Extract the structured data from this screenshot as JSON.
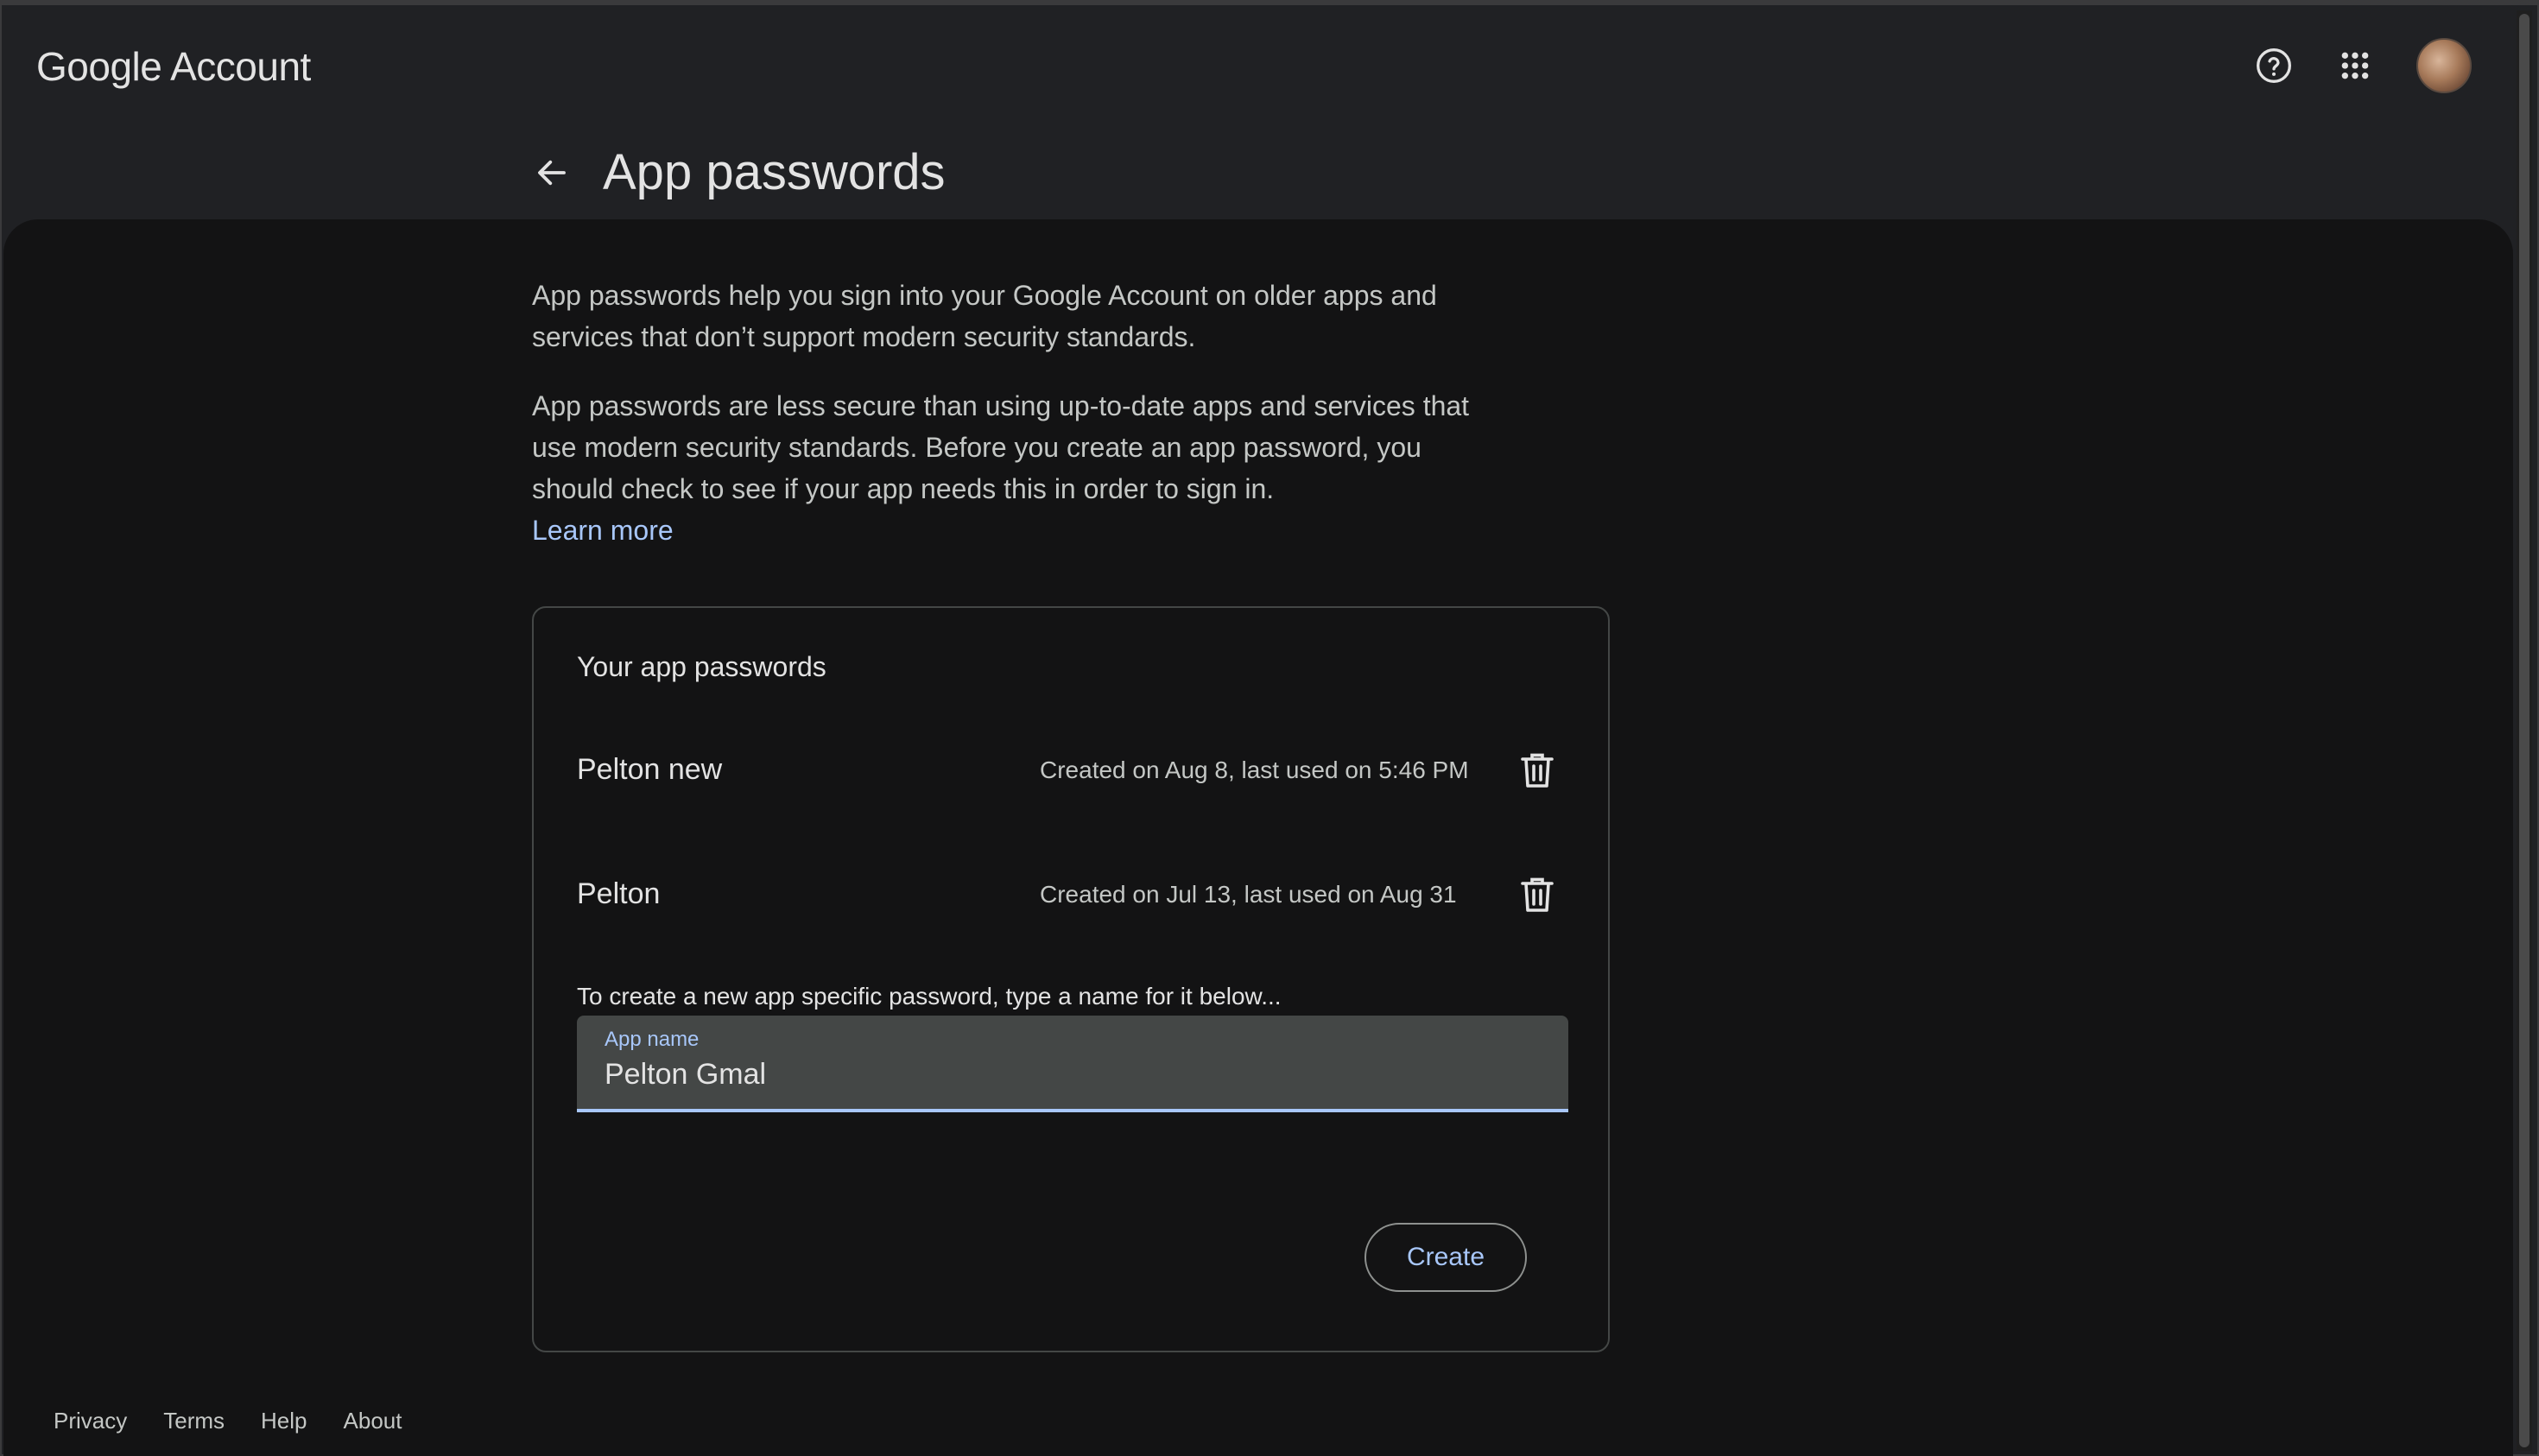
{
  "header": {
    "brand_google": "Google",
    "brand_account": "Account",
    "icons": [
      "help-icon",
      "apps-grid-icon"
    ],
    "avatar": "account-avatar"
  },
  "page": {
    "back_icon": "arrow-left-icon",
    "title": "App passwords"
  },
  "intro": {
    "paragraph1": "App passwords help you sign into your Google Account on older apps and services that don’t support modern security standards.",
    "paragraph2": "App passwords are less secure than using up-to-date apps and services that use modern security standards. Before you create an app password, you should check to see if your app needs this in order to sign in.",
    "learn_more": "Learn more"
  },
  "card": {
    "title": "Your app passwords",
    "passwords": [
      {
        "name": "Pelton new",
        "meta": "Created on Aug 8, last used on 5:46 PM",
        "delete_icon": "trash-icon"
      },
      {
        "name": "Pelton",
        "meta": "Created on Jul 13, last used on Aug 31",
        "delete_icon": "trash-icon"
      }
    ],
    "hint": "To create a new app specific password, type a name for it below...",
    "field": {
      "label": "App name",
      "value": "Pelton Gmal"
    },
    "create_label": "Create"
  },
  "footer": {
    "links": [
      "Privacy",
      "Terms",
      "Help",
      "About"
    ]
  },
  "colors": {
    "accent": "#a8c7fa",
    "background": "#131314",
    "surface": "#202124",
    "field": "#444746"
  }
}
